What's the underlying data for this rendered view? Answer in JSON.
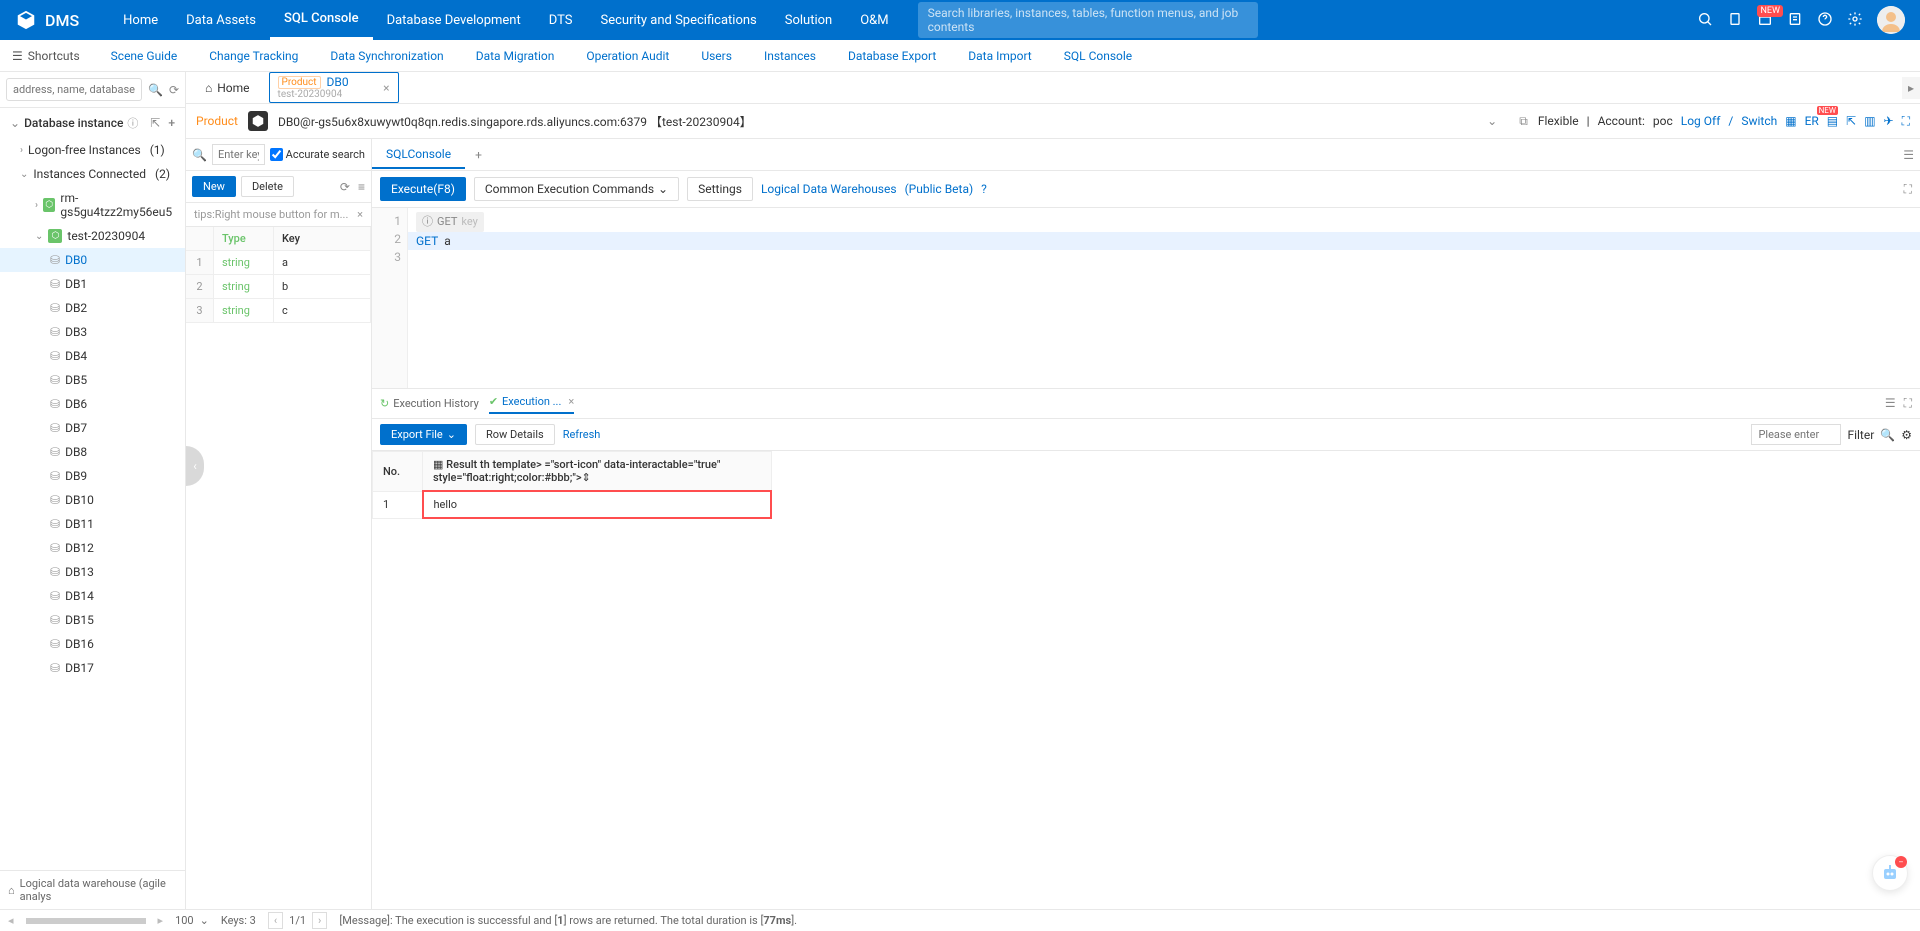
{
  "header": {
    "logo": "DMS",
    "nav": [
      "Home",
      "Data Assets",
      "SQL Console",
      "Database Development",
      "DTS",
      "Security and Specifications",
      "Solution",
      "O&M"
    ],
    "active_nav": "SQL Console",
    "search_placeholder": "Search libraries, instances, tables, function menus, and job contents",
    "badge_new": "NEW"
  },
  "subheader": {
    "shortcuts": "Shortcuts",
    "links": [
      "Scene Guide",
      "Change Tracking",
      "Data Synchronization",
      "Data Migration",
      "Operation Audit",
      "Users",
      "Instances",
      "Database Export",
      "Data Import",
      "SQL Console"
    ]
  },
  "sidebar": {
    "search_placeholder": "address, name, database name",
    "section_title": "Database instance",
    "logon_free": {
      "label": "Logon-free Instances",
      "count": "(1)"
    },
    "connected": {
      "label": "Instances Connected",
      "count": "(2)"
    },
    "instances": [
      {
        "name": "rm-gs5gu4tzz2my56eu5",
        "icon": "green"
      },
      {
        "name": "test-20230904",
        "icon": "green",
        "expanded": true
      }
    ],
    "dbs": [
      "DB0",
      "DB1",
      "DB2",
      "DB3",
      "DB4",
      "DB5",
      "DB6",
      "DB7",
      "DB8",
      "DB9",
      "DB10",
      "DB11",
      "DB12",
      "DB13",
      "DB14",
      "DB15",
      "DB16",
      "DB17"
    ],
    "active_db": "DB0",
    "footer_label": "Logical data warehouse (agile analys"
  },
  "tabs": {
    "home": "Home",
    "db_tab": {
      "env": "Product",
      "title": "DB0",
      "sub": "test-20230904"
    }
  },
  "conn_bar": {
    "env": "Product",
    "conn_str": "DB0@r-gs5u6x8xuwywt0q8qn.redis.singapore.rds.aliyuncs.com:6379 【test-20230904】",
    "flexible": "Flexible",
    "account_lbl": "Account:",
    "account": "poc",
    "logoff": "Log Off",
    "switch": "Switch",
    "sep": "/",
    "er": "ER",
    "new": "NEW"
  },
  "key_panel": {
    "search_placeholder": "Enter keyw",
    "accurate": "Accurate search",
    "accurate_checked": true,
    "new_btn": "New",
    "delete_btn": "Delete",
    "tips": "tips:Right mouse button for m...",
    "col_type": "Type",
    "col_key": "Key",
    "rows": [
      {
        "n": "1",
        "type": "string",
        "key": "a"
      },
      {
        "n": "2",
        "type": "string",
        "key": "b"
      },
      {
        "n": "3",
        "type": "string",
        "key": "c"
      }
    ]
  },
  "editor": {
    "tab": "SQLConsole",
    "execute": "Execute(F8)",
    "common": "Common Execution Commands",
    "settings": "Settings",
    "ldw": "Logical Data Warehouses",
    "beta": "(Public Beta)",
    "lines": [
      "1",
      "2",
      "3"
    ],
    "hint_cmd": "GET",
    "hint_arg": "key",
    "code_kw": "GET",
    "code_arg": "a"
  },
  "results": {
    "exec_history": "Execution History",
    "exec_tab": "Execution ...",
    "export": "Export File",
    "row_details": "Row Details",
    "refresh": "Refresh",
    "filter_ph": "Please enter",
    "filter_lbl": "Filter",
    "col_no": "No.",
    "col_result": "Result",
    "rows": [
      {
        "no": "1",
        "result": "hello"
      }
    ]
  },
  "footer": {
    "page_size": "100",
    "keys_lbl": "Keys:",
    "keys": "3",
    "page": "1/1",
    "msg_pre": "[Message]: The execution is successful and [",
    "msg_rows": "1",
    "msg_mid": "] rows are returned. The total duration is [",
    "msg_ms": "77ms",
    "msg_suf": "]."
  }
}
